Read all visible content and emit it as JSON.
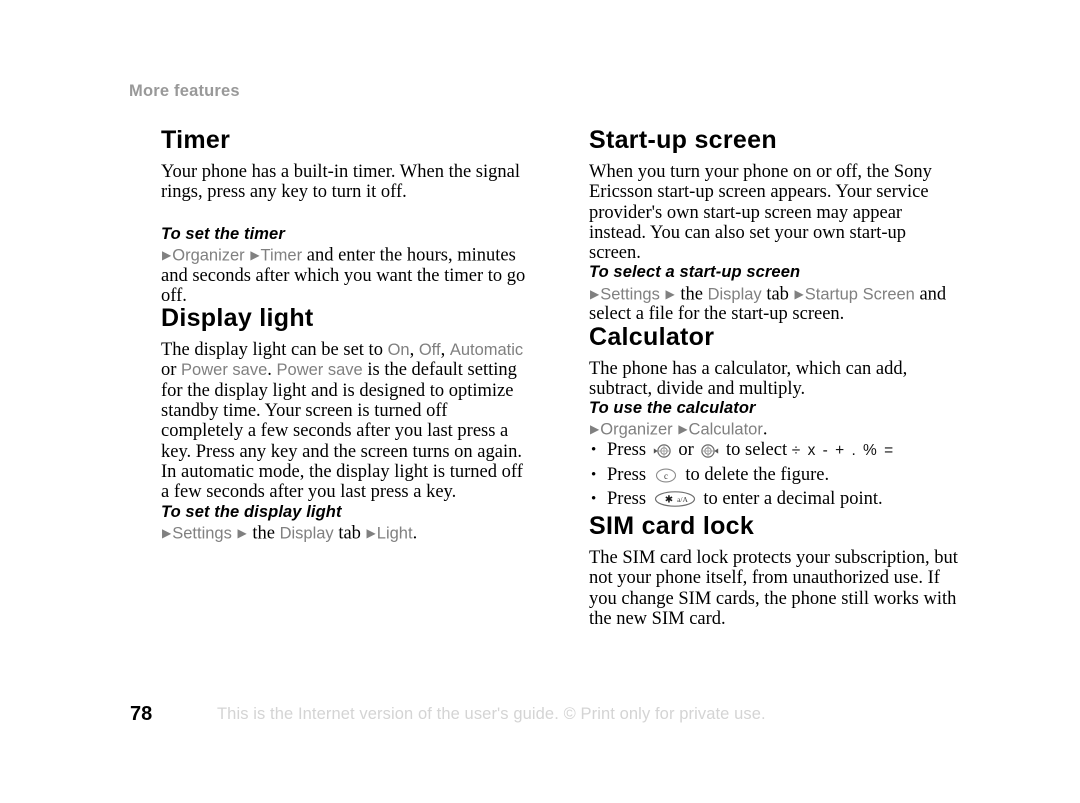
{
  "document": {
    "running_header": "More features",
    "page_number": "78",
    "footer_note": "This is the Internet version of the user's guide. © Print only for private use."
  },
  "colors": {
    "ui_term": "#808080",
    "running_header": "#999999",
    "footer_note": "#d4d4d4",
    "body_text": "#000000"
  },
  "left_column": {
    "timer": {
      "heading": "Timer",
      "paragraph": "Your phone has a built-in timer. When the signal rings, press any key to turn it off.",
      "task_heading": "To set the timer",
      "step": {
        "arrow1": "▶",
        "term1": "Organizer",
        "arrow2": "▶",
        "term2": "Timer",
        "tail": " and enter the hours, minutes and seconds after which you want the timer to go off."
      }
    },
    "display_light": {
      "heading": "Display light",
      "paragraph": {
        "p1": "The display light can be set to ",
        "opt_on": "On",
        "sep1": ", ",
        "opt_off": "Off",
        "sep2": ", ",
        "opt_auto": "Automatic",
        "p2": " or ",
        "opt_power_save_1": "Power save",
        "p3": ". ",
        "opt_power_save_2": "Power save",
        "p4": " is the default setting for the display light and is designed to optimize standby time. Your screen is turned off  completely a few seconds after you last press a key. Press any key and the screen turns on again. In automatic mode, the display light is turned off a few seconds after you last press a key."
      },
      "task_heading": "To set the display light",
      "step": {
        "arrow1": "▶",
        "term1": "Settings",
        "arrow2": "▶",
        "mid": " the ",
        "term2": "Display",
        "mid2": " tab ",
        "arrow3": "▶",
        "term3": "Light",
        "tail": "."
      }
    }
  },
  "right_column": {
    "startup_screen": {
      "heading": "Start-up screen",
      "paragraph": "When you turn your phone on or off, the Sony Ericsson start-up screen appears. Your service provider's own start-up screen may appear instead. You can also set your own start-up screen.",
      "task_heading": "To select a start-up screen",
      "step": {
        "arrow1": "▶",
        "term1": "Settings",
        "arrow2": "▶",
        "mid": " the ",
        "term2": "Display",
        "mid2": " tab ",
        "arrow3": "▶",
        "term3": "Startup Screen",
        "tail": " and select a file for the start-up screen."
      }
    },
    "calculator": {
      "heading": "Calculator",
      "paragraph": "The phone has a calculator, which can add, subtract, divide and multiply.",
      "task_heading": "To use the calculator",
      "step": {
        "arrow1": "▶",
        "term1": "Organizer",
        "arrow2": "▶",
        "term2": "Calculator",
        "tail": "."
      },
      "bullets": [
        {
          "bullet": "•",
          "pre": "Press ",
          "icon1": "joystick-left-icon",
          "mid": " or ",
          "icon2": "joystick-right-icon",
          "post": " to select ",
          "operators": "÷ x - + . % ="
        },
        {
          "bullet": "•",
          "pre": "Press ",
          "icon1": "clear-key-icon",
          "icon_label": "c",
          "post": " to delete the figure."
        },
        {
          "bullet": "•",
          "pre": "Press ",
          "icon1": "star-key-icon",
          "icon_label": "✳ a/A",
          "post": " to enter a decimal point."
        }
      ]
    },
    "sim_card_lock": {
      "heading": "SIM card lock",
      "paragraph": "The SIM card lock protects your subscription, but not your phone itself, from unauthorized use. If you change SIM cards, the phone still works with the new SIM card."
    }
  }
}
